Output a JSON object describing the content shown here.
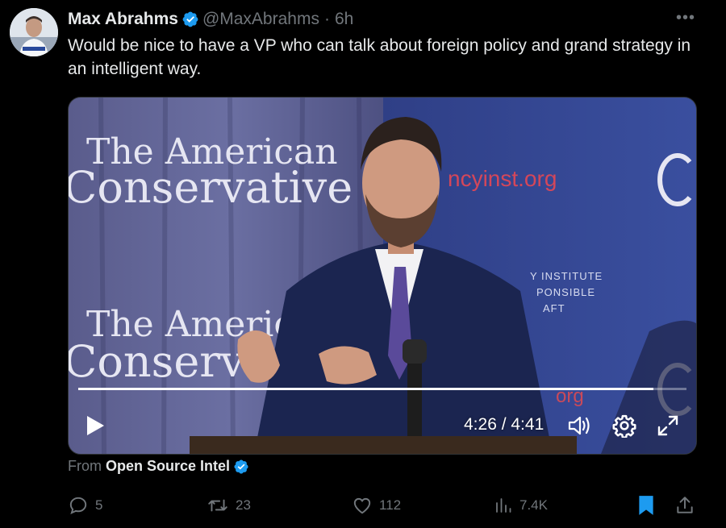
{
  "tweet": {
    "author_name": "Max Abrahms",
    "handle": "@MaxAbrahms",
    "separator": "·",
    "time": "6h",
    "text": "Would be nice to have a VP who can talk about foreign policy and grand strategy in an intelligent way.",
    "more_icon": "more-horizontal-icon",
    "verified_icon": "verified-badge-icon"
  },
  "media": {
    "backdrop_banner_text_1": "The American",
    "backdrop_banner_text_2": "Conservative",
    "backdrop_banner_text_3": "The America",
    "backdrop_banner_text_4": "Conserv",
    "backdrop_right_url": "ncyinst.org",
    "backdrop_right_line1": "Y INSTITUTE",
    "backdrop_right_line2": "PONSIBLE",
    "backdrop_right_line3": "AFT",
    "backdrop_right_url2": "org",
    "player": {
      "time_display": "4:26 / 4:41",
      "progress_fraction": 0.945,
      "play_icon": "play-icon",
      "volume_icon": "volume-icon",
      "settings_icon": "settings-gear-icon",
      "fullscreen_icon": "fullscreen-expand-icon"
    }
  },
  "source": {
    "prefix": "From",
    "name": "Open Source Intel"
  },
  "actions": {
    "replies": "5",
    "retweets": "23",
    "likes": "112",
    "views": "7.4K"
  },
  "colors": {
    "background": "#000000",
    "text_primary": "#e7e9ea",
    "text_secondary": "#71767b",
    "verified_blue": "#1d9bf0",
    "bookmark_active": "#1d9bf0"
  }
}
